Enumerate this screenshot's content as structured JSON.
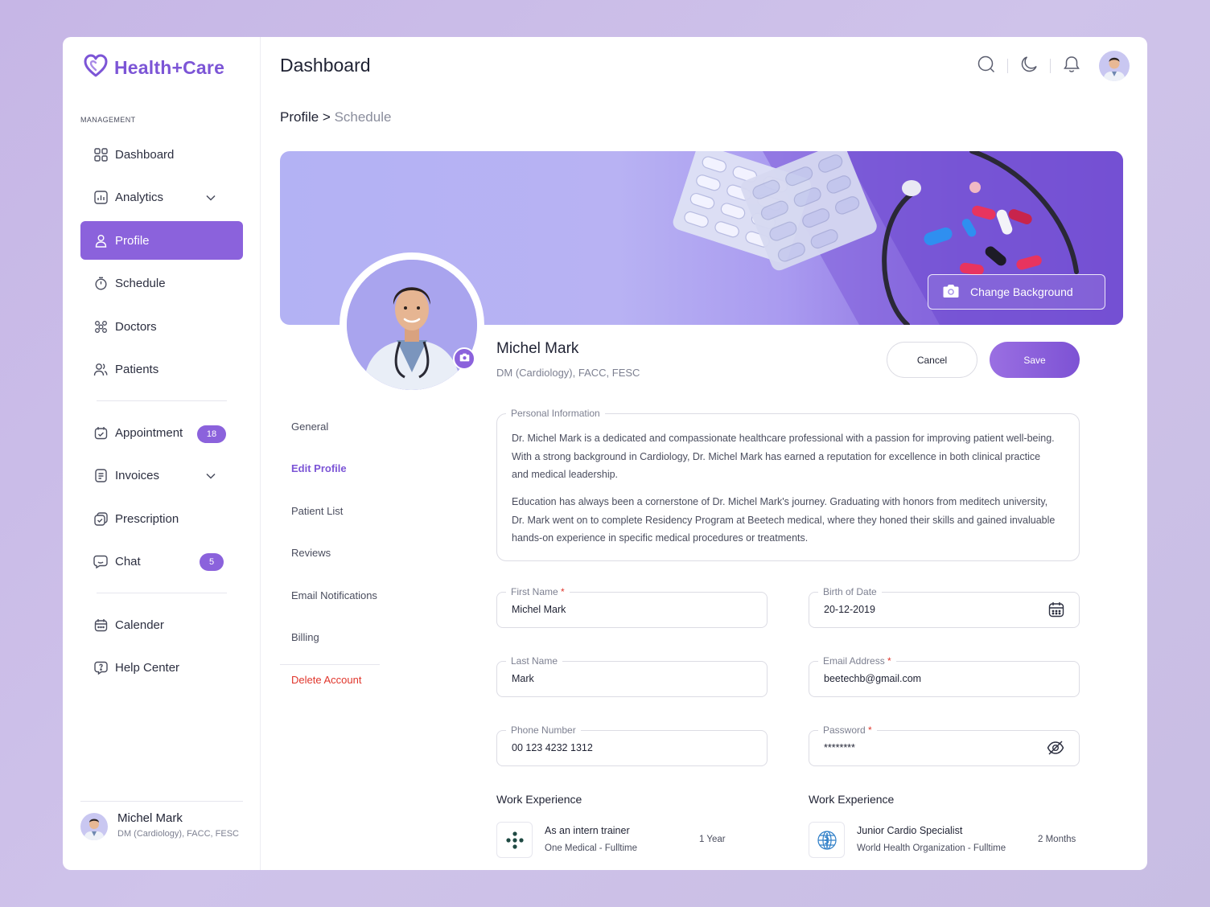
{
  "brand": {
    "name": "Health+Care",
    "color": "#7c55d6",
    "icon": "heart-logo-icon"
  },
  "sidebar": {
    "section_label": "MANAGEMENT",
    "items": [
      {
        "label": "Dashboard",
        "icon": "grid-icon"
      },
      {
        "label": "Analytics",
        "icon": "chart-icon",
        "expandable": true
      },
      {
        "label": "Profile",
        "icon": "user-icon",
        "active": true
      },
      {
        "label": "Schedule",
        "icon": "timer-icon"
      },
      {
        "label": "Doctors",
        "icon": "group-icon"
      },
      {
        "label": "Patients",
        "icon": "users-icon"
      },
      {
        "label": "Appointment",
        "icon": "calendar-check-icon",
        "badge": "18"
      },
      {
        "label": "Invoices",
        "icon": "invoice-icon",
        "expandable": true
      },
      {
        "label": "Prescription",
        "icon": "prescription-icon"
      },
      {
        "label": "Chat",
        "icon": "chat-icon",
        "badge": "5"
      },
      {
        "label": "Calender",
        "icon": "calendar-icon"
      },
      {
        "label": "Help Center",
        "icon": "help-icon"
      }
    ],
    "user": {
      "name": "Michel Mark",
      "title": "DM (Cardiology), FACC, FESC"
    }
  },
  "header": {
    "title": "Dashboard",
    "icons": [
      "search-icon",
      "moon-icon",
      "bell-icon"
    ]
  },
  "breadcrumb": {
    "parent": "Profile",
    "separator": " > ",
    "current": "Schedule"
  },
  "banner": {
    "change_background": "Change Background"
  },
  "profile": {
    "name": "Michel Mark",
    "title": "DM (Cardiology), FACC, FESC",
    "cancel": "Cancel",
    "save": "Save"
  },
  "settings_menu": [
    {
      "label": "General"
    },
    {
      "label": "Edit Profile",
      "active": true
    },
    {
      "label": "Patient List"
    },
    {
      "label": "Reviews"
    },
    {
      "label": "Email Notifications"
    },
    {
      "label": "Billing"
    },
    {
      "label": "Delete Account",
      "danger": true
    }
  ],
  "personal_info": {
    "legend": "Personal Information",
    "paragraphs": [
      "Dr. Michel Mark is a dedicated and compassionate healthcare professional with a passion for improving patient well-being. With a strong background in Cardiology, Dr. Michel Mark has earned a reputation for excellence in both clinical practice and medical leadership.",
      "Education has always been a cornerstone of Dr. Michel Mark's journey. Graduating with honors from meditech university, Dr.  Mark went on to complete Residency Program at Beetech medical, where they honed their skills and gained invaluable hands-on experience in specific medical procedures or treatments."
    ]
  },
  "form": {
    "first_name": {
      "label": "First Name",
      "required": "*",
      "value": "Michel Mark"
    },
    "birth_date": {
      "label": "Birth of Date",
      "value": "20-12-2019"
    },
    "last_name": {
      "label": "Last Name",
      "value": "Mark"
    },
    "email": {
      "label": "Email Address",
      "required": "*",
      "value": "beetechb@gmail.com"
    },
    "phone": {
      "label": "Phone Number",
      "value": "00 123 4232 1312"
    },
    "password": {
      "label": "Password",
      "required": "*",
      "value": "********"
    }
  },
  "work_experience": [
    {
      "heading": "Work Experience",
      "role": "As an intern trainer",
      "org": "One Medical - Fulltime",
      "duration": "1 Year"
    },
    {
      "heading": "Work Experience",
      "role": "Junior Cardio Specialist",
      "org": "World Health Organization - Fulltime",
      "duration": "2 Months"
    }
  ],
  "colors": {
    "accent": "#8b62dc",
    "danger": "#e0352b",
    "text": "#1f2233",
    "muted": "#7d8091"
  }
}
